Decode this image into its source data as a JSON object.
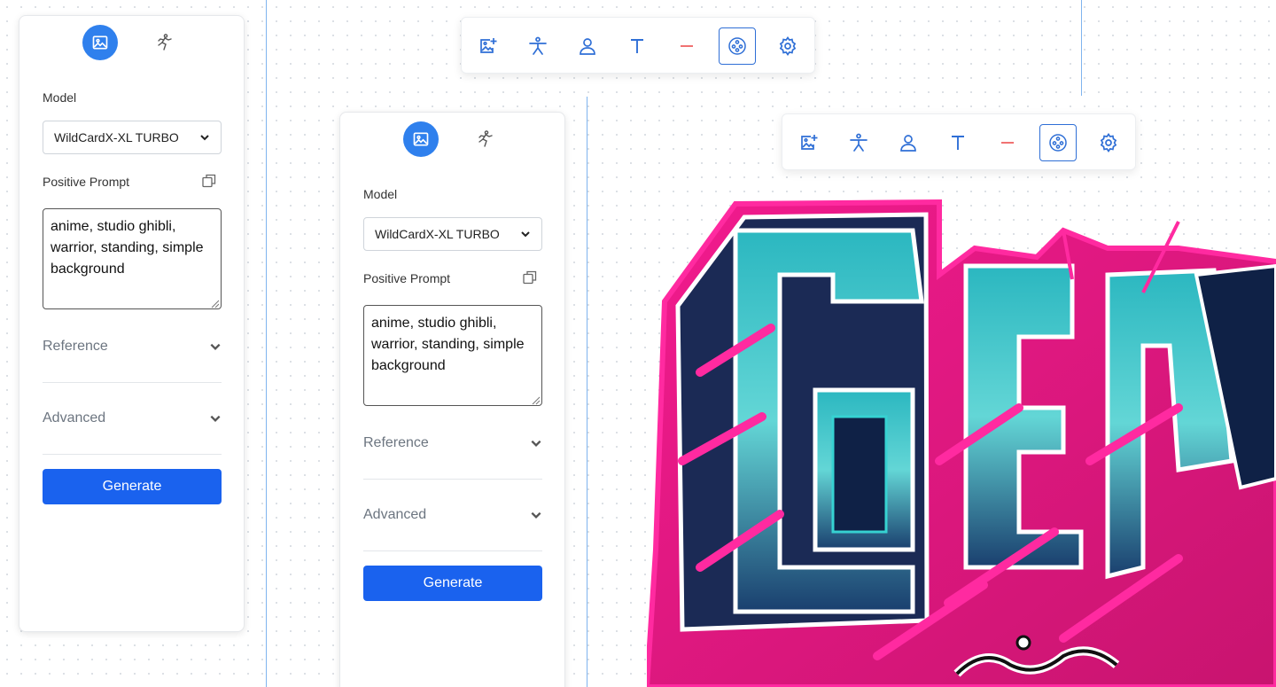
{
  "colors": {
    "accent": "#1a62ee",
    "mode_active": "#2f80ed",
    "icon_blue": "#2f6fd6",
    "icon_red": "#f06a6a",
    "guide_line": "#7fb4ee"
  },
  "toolbar_icons": [
    "add-image-icon",
    "pose-figure-icon",
    "person-icon",
    "text-icon",
    "minus-icon",
    "render-reel-icon",
    "gear-icon"
  ],
  "panels": [
    {
      "model_label": "Model",
      "model_value": "WildCardX-XL TURBO",
      "prompt_label": "Positive Prompt",
      "prompt_value": "anime, studio ghibli, warrior, standing, simple background",
      "reference_label": "Reference",
      "advanced_label": "Advanced",
      "generate_label": "Generate"
    },
    {
      "model_label": "Model",
      "model_value": "WildCardX-XL TURBO",
      "prompt_label": "Positive Prompt",
      "prompt_value": "anime, studio ghibli, warrior, standing, simple background",
      "reference_label": "Reference",
      "advanced_label": "Advanced",
      "generate_label": "Generate"
    }
  ]
}
